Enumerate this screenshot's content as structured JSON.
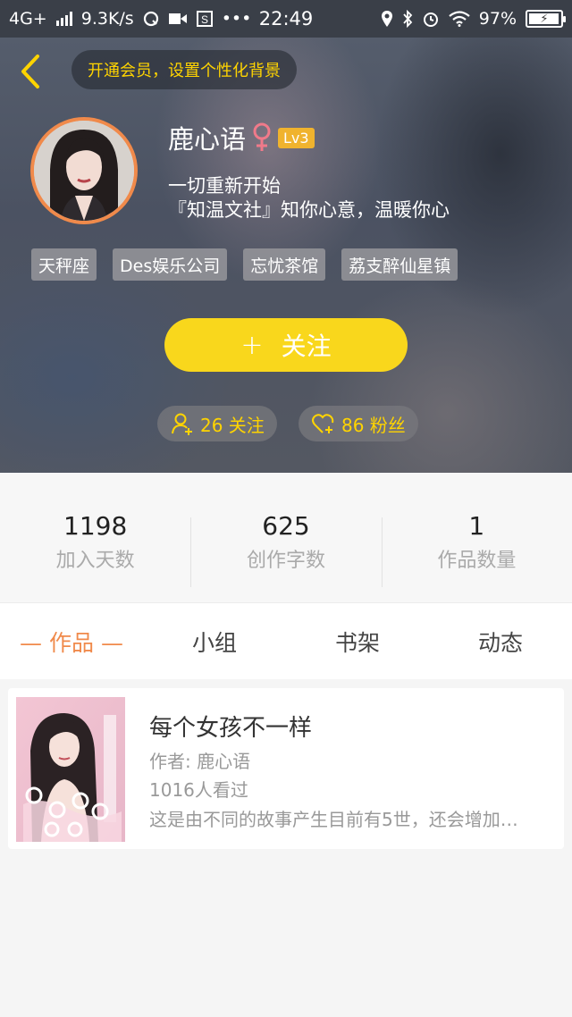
{
  "status_bar": {
    "network": "4G+",
    "speed": "9.3K/s",
    "time": "22:49",
    "battery": "97%",
    "more": "•••"
  },
  "header": {
    "back_icon": "chevron-left-icon",
    "vip_prompt": "开通会员，设置个性化背景",
    "user_name": "鹿心语",
    "gender_icon": "female-icon",
    "level": "Lv3",
    "bio_line_1": "一切重新开始",
    "bio_line_2": "『知温文社』知你心意，温暖你心",
    "tags": [
      "天秤座",
      "Des娱乐公司",
      "忘忧茶馆",
      "荔支醉仙星镇"
    ],
    "follow_button": {
      "plus": "+",
      "label": "关注"
    },
    "following": {
      "label": "26 关注",
      "icon": "add-user-icon"
    },
    "fans": {
      "label": "86 粉丝",
      "icon": "heart-plus-icon"
    }
  },
  "stats": [
    {
      "num": "1198",
      "label": "加入天数"
    },
    {
      "num": "625",
      "label": "创作字数"
    },
    {
      "num": "1",
      "label": "作品数量"
    }
  ],
  "tabs": [
    {
      "label": "作品",
      "active": true
    },
    {
      "label": "小组",
      "active": false
    },
    {
      "label": "书架",
      "active": false
    },
    {
      "label": "动态",
      "active": false
    }
  ],
  "works": [
    {
      "title": "每个女孩不一样",
      "author": "作者: 鹿心语",
      "views": "1016人看过",
      "description": "这是由不同的故事产生目前有5世，还会增加…"
    }
  ],
  "colors": {
    "accent_yellow": "#f9d71c",
    "accent_orange": "#f08a4b",
    "level_badge": "#f0b32e"
  }
}
